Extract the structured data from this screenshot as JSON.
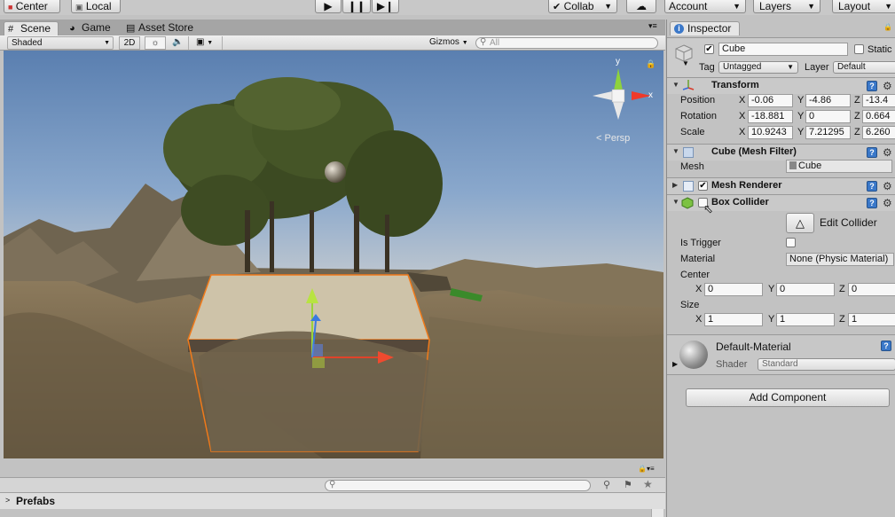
{
  "toolbar": {
    "pivot_label": "Center",
    "space_label": "Local",
    "collab_label": "Collab",
    "account_label": "Account",
    "layers_label": "Layers",
    "layout_label": "Layout"
  },
  "scene_tabs": {
    "scene_label": "Scene",
    "game_label": "Game",
    "asset_store_label": "Asset Store"
  },
  "scene_toolbar": {
    "shading_mode": "Shaded",
    "mode_2d_label": "2D",
    "gizmos_label": "Gizmos",
    "search_placeholder": "All"
  },
  "viewport": {
    "persp_label": "Persp",
    "axis_y": "y",
    "axis_x": "x"
  },
  "bottom_panel": {
    "prefabs_label": "Prefabs"
  },
  "inspector": {
    "tab_label": "Inspector",
    "object_name": "Cube",
    "static_label": "Static",
    "tag_label": "Tag",
    "tag_value": "Untagged",
    "layer_label": "Layer",
    "layer_value": "Default",
    "transform": {
      "title": "Transform",
      "position_label": "Position",
      "rotation_label": "Rotation",
      "scale_label": "Scale",
      "position": {
        "x": "-0.06",
        "y": "-4.86",
        "z": "-13.4"
      },
      "rotation": {
        "x": "-18.881",
        "y": "0",
        "z": "0.664"
      },
      "scale": {
        "x": "10.9243",
        "y": "7.21295",
        "z": "6.260"
      }
    },
    "mesh_filter": {
      "title": "Cube (Mesh Filter)",
      "mesh_label": "Mesh",
      "mesh_value": "Cube"
    },
    "mesh_renderer": {
      "title": "Mesh Renderer"
    },
    "box_collider": {
      "title": "Box Collider",
      "edit_collider_label": "Edit Collider",
      "is_trigger_label": "Is Trigger",
      "material_label": "Material",
      "material_value": "None (Physic Material)",
      "center_label": "Center",
      "center": {
        "x": "0",
        "y": "0",
        "z": "0"
      },
      "size_label": "Size",
      "size": {
        "x": "1",
        "y": "1",
        "z": "1"
      }
    },
    "material": {
      "name": "Default-Material",
      "shader_label": "Shader",
      "shader_value": "Standard"
    },
    "add_component_label": "Add Component",
    "axis_labels": {
      "x": "X",
      "y": "Y",
      "z": "Z"
    }
  }
}
